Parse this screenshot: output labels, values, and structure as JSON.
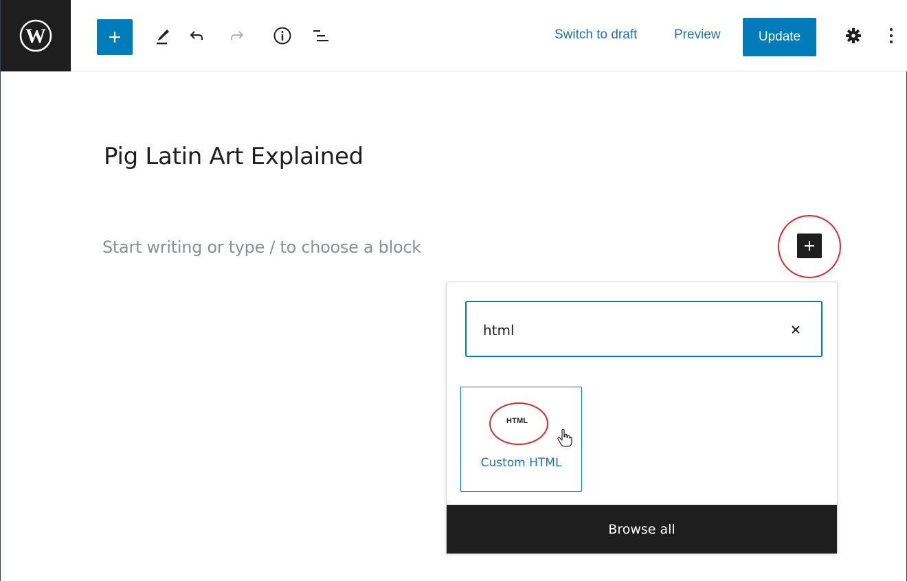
{
  "toolbar": {
    "switch_to_draft": "Switch to draft",
    "preview": "Preview",
    "update": "Update",
    "icons": [
      "wordpress-logo-icon",
      "plus-icon",
      "pencil-icon",
      "undo-icon",
      "redo-icon",
      "info-icon",
      "list-view-icon",
      "gear-icon",
      "more-vertical-icon"
    ]
  },
  "editor": {
    "title": "Pig Latin Art Explained",
    "placeholder": "Start writing or type / to choose a block"
  },
  "inserter": {
    "search_value": "html",
    "results": [
      {
        "icon_text": "HTML",
        "label": "Custom HTML"
      }
    ],
    "browse_all": "Browse all"
  },
  "colors": {
    "accent": "#007cba",
    "dark": "#1e1e1e",
    "link": "#2271b1",
    "annotation_red": "#e0262a",
    "placeholder": "#8c8f94"
  }
}
